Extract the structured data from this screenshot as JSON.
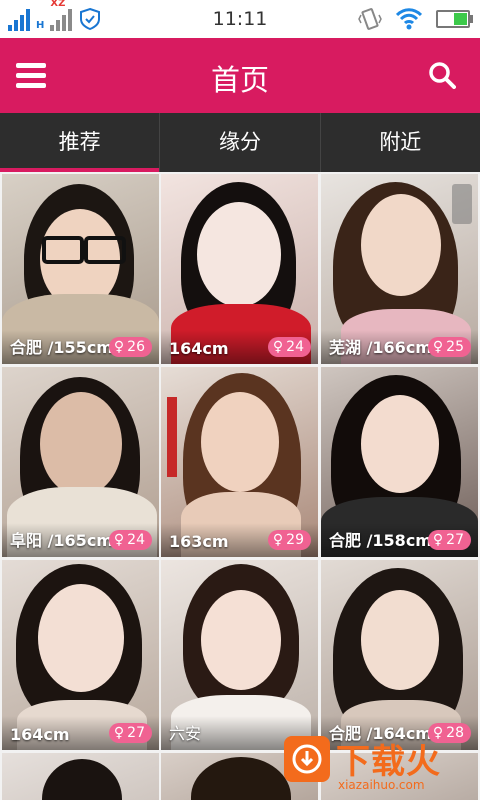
{
  "status_bar": {
    "time": "11:11",
    "network_label": "H",
    "roaming_label": "XZ",
    "battery_level": 0.45,
    "icons": [
      "signal-icon",
      "signal-icon-secondary",
      "shield-icon",
      "vibrate-icon",
      "wifi-icon",
      "battery-icon"
    ]
  },
  "header": {
    "title": "首页",
    "menu_icon": "menu-icon",
    "search_icon": "search-icon"
  },
  "tabs": [
    {
      "label": "推荐",
      "active": true
    },
    {
      "label": "缘分",
      "active": false
    },
    {
      "label": "附近",
      "active": false
    }
  ],
  "cards": [
    {
      "info": "合肥 /155cm",
      "age": "26"
    },
    {
      "info": "164cm",
      "age": "24"
    },
    {
      "info": "芜湖 /166cm",
      "age": "25"
    },
    {
      "info": "阜阳 /165cm",
      "age": "24"
    },
    {
      "info": "163cm",
      "age": "29"
    },
    {
      "info": "合肥 /158cm",
      "age": "27"
    },
    {
      "info": "164cm",
      "age": "27"
    },
    {
      "info": "六安",
      "age": ""
    },
    {
      "info": "合肥 /164cm",
      "age": "28"
    },
    {
      "info": "",
      "age": ""
    },
    {
      "info": "",
      "age": ""
    },
    {
      "info": "",
      "age": ""
    }
  ],
  "gender_symbol": "♀",
  "watermark": {
    "text": "下载火",
    "url": "xiazaihuo.com"
  },
  "colors": {
    "primary": "#d81b60",
    "tab_bar": "#2d2d2d",
    "age_badge": "#f06292",
    "watermark": "#f36b1c"
  }
}
